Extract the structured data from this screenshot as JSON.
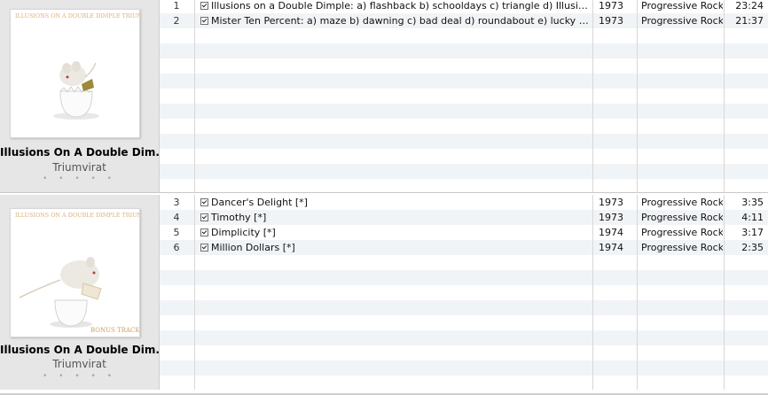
{
  "albums": [
    {
      "title": "Illusions On A Double Dim...",
      "artist": "Triumvirat",
      "rating": "• • • • •",
      "cover_text": "ILLUSIONS ON A DOUBLE DIMPLE TRIUMVIRAT",
      "cover_subtext": "",
      "tracks": [
        {
          "num": "1",
          "checked": true,
          "name": "Illusions on a Double Dimple: a) flashback b) schooldays c) triangle d) Illusions e) dimpli...",
          "year": "1973",
          "genre": "Progressive Rock",
          "time": "23:24"
        },
        {
          "num": "2",
          "checked": true,
          "name": "Mister Ten Percent: a) maze b) dawning c) bad deal d) roundabout e) lucky girl f) millio...",
          "year": "1973",
          "genre": "Progressive Rock",
          "time": "21:37"
        }
      ]
    },
    {
      "title": "Illusions On A Double Dim...",
      "artist": "Triumvirat",
      "rating": "• • • • •",
      "cover_text": "ILLUSIONS ON A DOUBLE DIMPLE TRIUMVIRAT",
      "cover_subtext": "BONUS TRACKS",
      "tracks": [
        {
          "num": "3",
          "checked": true,
          "name": "Dancer's Delight [*]",
          "year": "1973",
          "genre": "Progressive Rock",
          "time": "3:35"
        },
        {
          "num": "4",
          "checked": true,
          "name": "Timothy [*]",
          "year": "1973",
          "genre": "Progressive Rock",
          "time": "4:11"
        },
        {
          "num": "5",
          "checked": true,
          "name": "Dimplicity [*]",
          "year": "1974",
          "genre": "Progressive Rock",
          "time": "3:17"
        },
        {
          "num": "6",
          "checked": true,
          "name": "Million Dollars [*]",
          "year": "1974",
          "genre": "Progressive Rock",
          "time": "2:35"
        }
      ]
    }
  ],
  "colors": {
    "cover_text": "#d8b27a",
    "bonus_text": "#c8a060",
    "egg_shadow": "#e4e4e4",
    "mouse": "#eae6e0",
    "ticket": "#9a8a3a"
  }
}
